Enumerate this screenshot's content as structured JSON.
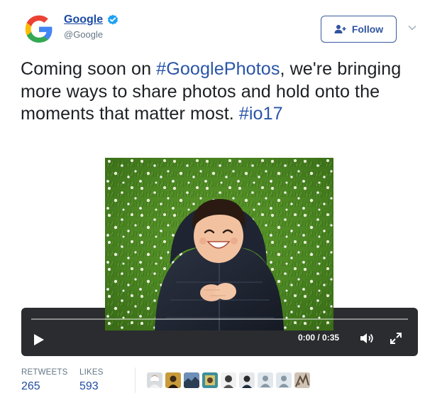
{
  "author": {
    "name": "Google",
    "handle": "@Google",
    "logo_icon": "google-g-logo",
    "verified_icon": "verified-badge-icon"
  },
  "follow_button": {
    "label": "Follow",
    "icon": "add-user-icon"
  },
  "menu_icon": "chevron-down-icon",
  "tweet": {
    "segments": [
      {
        "text": "Coming soon on ",
        "type": "text"
      },
      {
        "text": "#GooglePhotos",
        "type": "hashtag"
      },
      {
        "text": ", we're bringing more ways to share photos and hold onto the moments that matter most. ",
        "type": "text"
      },
      {
        "text": "#io17",
        "type": "hashtag"
      }
    ]
  },
  "video": {
    "current_time": "0:00",
    "separator": " / ",
    "duration": "0:35",
    "progress": 0,
    "play_icon": "play-icon",
    "volume_icon": "volume-icon",
    "fullscreen_icon": "fullscreen-icon"
  },
  "stats": {
    "retweets_label": "RETWEETS",
    "retweets_count": "265",
    "likes_label": "LIKES",
    "likes_count": "593"
  },
  "likers": [
    {
      "icon": "avatar-1"
    },
    {
      "icon": "avatar-2"
    },
    {
      "icon": "avatar-3"
    },
    {
      "icon": "avatar-4"
    },
    {
      "icon": "avatar-5"
    },
    {
      "icon": "avatar-6"
    },
    {
      "icon": "avatar-default-7"
    },
    {
      "icon": "avatar-default-8"
    },
    {
      "icon": "avatar-9"
    }
  ],
  "colors": {
    "link_blue": "#1b4aa4",
    "hashtag_blue": "#2a55a8",
    "muted_gray": "#657786",
    "verified_blue": "#1da1f2",
    "video_bar": "#2b2c2f"
  }
}
